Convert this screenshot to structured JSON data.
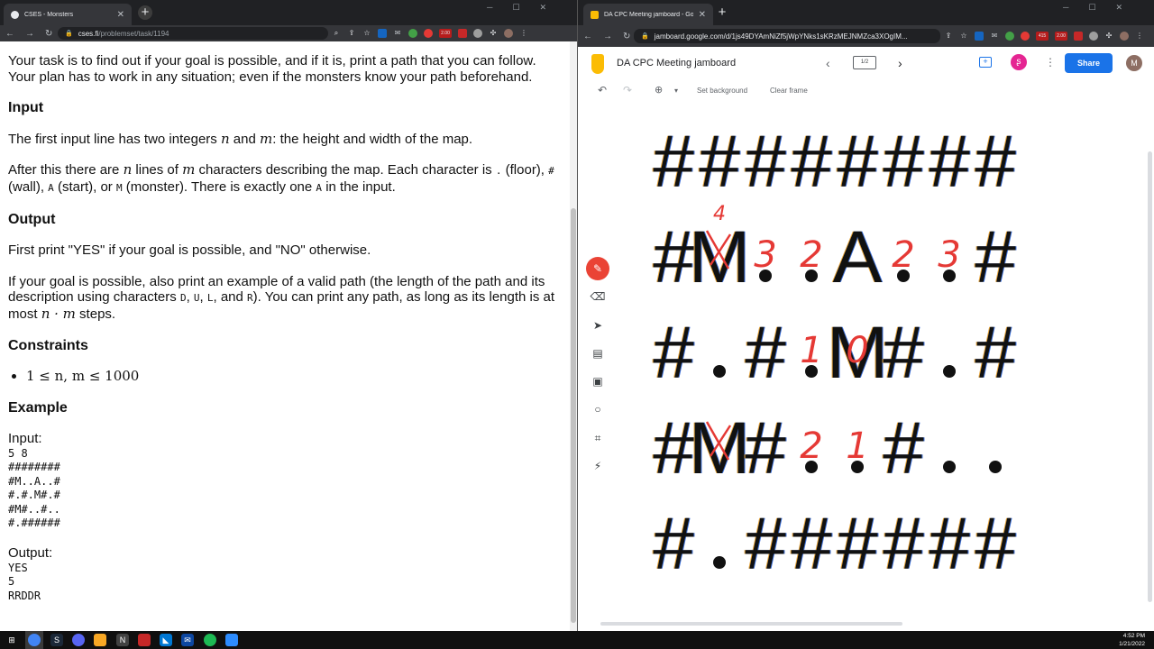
{
  "left_window": {
    "tab_title": "CSES - Monsters",
    "url_domain": "cses.fi",
    "url_path": "/problemset/task/1194",
    "intro": "Your task is to find out if your goal is possible, and if it is, print a path that you can follow. Your plan has to work in any situation; even if the monsters know your path beforehand.",
    "input_heading": "Input",
    "input_p1_a": "The first input line has two integers ",
    "input_p1_n": "n",
    "input_p1_b": " and ",
    "input_p1_m": "m",
    "input_p1_c": ": the height and width of the map.",
    "input_p2_a": "After this there are ",
    "input_p2_n": "n",
    "input_p2_b": " lines of ",
    "input_p2_m": "m",
    "input_p2_c": " characters describing the map. Each character is ",
    "char_floor": ".",
    "input_p2_d": " (floor), ",
    "char_wall": "#",
    "input_p2_e": " (wall), ",
    "char_start": "A",
    "input_p2_f": " (start), or ",
    "char_monster": "M",
    "input_p2_g": " (monster). There is exactly one ",
    "char_a2": "A",
    "input_p2_h": " in the input.",
    "output_heading": "Output",
    "output_p1": "First print \"YES\" if your goal is possible, and \"NO\" otherwise.",
    "output_p2_a": "If your goal is possible, also print an example of a valid path (the length of the path and its description using characters ",
    "char_d": "D",
    "sep1": ", ",
    "char_u": "U",
    "sep2": ", ",
    "char_l": "L",
    "sep3": ", and ",
    "char_r": "R",
    "output_p2_b": "). You can print any path, as long as its length is at most ",
    "output_p2_math": "n · m",
    "output_p2_c": " steps.",
    "constraints_heading": "Constraints",
    "constraint": "1 ≤ n, m ≤ 1000",
    "example_heading": "Example",
    "input_label": "Input:",
    "input_example": "5 8\n########\n#M..A..#\n#.#.M#.#\n#M#..#..\n#.######",
    "output_label": "Output:",
    "output_example": "YES\n5\nRRDDR"
  },
  "right_window": {
    "tab_title": "DA CPC Meeting jamboard - Google Ja",
    "url": "jamboard.google.com/d/1js49DYAmNiZf5jWpYNks1sKRzMEJNMZca3XOgIM...",
    "doc_title": "DA CPC Meeting jamboard",
    "frame_indicator": "1/2",
    "share_label": "Share",
    "avatar_letter": "M",
    "set_background": "Set background",
    "clear_frame": "Clear frame",
    "grid_rows": [
      "########",
      "#M..A..#",
      "#.#.M#.#",
      "#M#..#..",
      "#.######"
    ],
    "annotations": [
      {
        "row": 1,
        "col": 1,
        "text": "4"
      },
      {
        "row": 1,
        "col": 2,
        "text": "3"
      },
      {
        "row": 1,
        "col": 3,
        "text": "2"
      },
      {
        "row": 1,
        "col": 5,
        "text": "2"
      },
      {
        "row": 1,
        "col": 6,
        "text": "3"
      },
      {
        "row": 2,
        "col": 3,
        "text": "1"
      },
      {
        "row": 2,
        "col": 4,
        "text": "0"
      },
      {
        "row": 3,
        "col": 3,
        "text": "2"
      },
      {
        "row": 3,
        "col": 4,
        "text": "1"
      }
    ],
    "crossed_cells": [
      {
        "row": 1,
        "col": 1
      },
      {
        "row": 3,
        "col": 1
      }
    ],
    "ink_color": "#e53935"
  },
  "extension_badges": {
    "badge_a": "2.00",
    "badge_b": "415"
  },
  "clock": {
    "time": "4:52 PM",
    "date": "1/21/2022"
  },
  "colors": {
    "accent": "#1a73e8",
    "tab_bg": "#202124",
    "toolbar": "#35363a"
  }
}
